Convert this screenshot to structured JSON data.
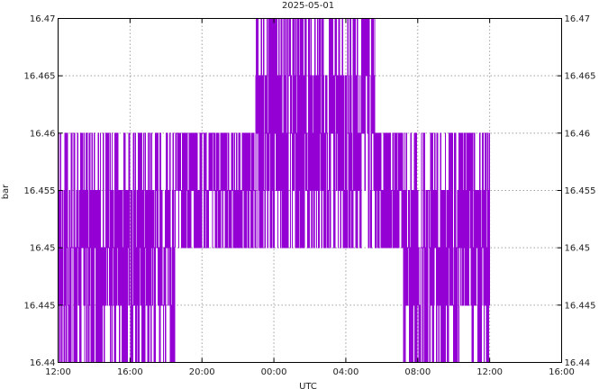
{
  "chart_data": {
    "type": "line",
    "title": "2025-05-01",
    "xlabel": "UTC",
    "ylabel": "bar",
    "x_unit": "hours since 12:00",
    "xlim": [
      0,
      28
    ],
    "ylim": [
      16.44,
      16.47
    ],
    "x_ticks": [
      {
        "x": 0,
        "label": "12:00"
      },
      {
        "x": 4,
        "label": "16:00"
      },
      {
        "x": 8,
        "label": "20:00"
      },
      {
        "x": 12,
        "label": "00:00"
      },
      {
        "x": 16,
        "label": "04:00"
      },
      {
        "x": 20,
        "label": "08:00"
      },
      {
        "x": 24,
        "label": "12:00"
      },
      {
        "x": 28,
        "label": "16:00"
      }
    ],
    "y_ticks": [
      {
        "y": 16.44,
        "label": "16.44"
      },
      {
        "y": 16.445,
        "label": "16.445"
      },
      {
        "y": 16.45,
        "label": "16.45"
      },
      {
        "y": 16.455,
        "label": "16.455"
      },
      {
        "y": 16.46,
        "label": "16.46"
      },
      {
        "y": 16.465,
        "label": "16.465"
      },
      {
        "y": 16.47,
        "label": "16.47"
      }
    ],
    "grid": true,
    "legend": "none",
    "series_color": "#9400d3",
    "series": [
      {
        "segments": [
          {
            "x0": 0.0,
            "x1": 6.5,
            "levels": [
              16.44,
              16.445,
              16.45,
              16.455,
              16.46
            ]
          },
          {
            "x0": 6.5,
            "x1": 11.0,
            "levels": [
              16.45,
              16.455,
              16.46
            ]
          },
          {
            "x0": 11.0,
            "x1": 17.6,
            "levels": [
              16.45,
              16.455,
              16.46,
              16.465,
              16.47
            ]
          },
          {
            "x0": 17.6,
            "x1": 19.2,
            "levels": [
              16.45,
              16.455,
              16.46
            ]
          },
          {
            "x0": 19.2,
            "x1": 24.0,
            "levels": [
              16.44,
              16.445,
              16.45,
              16.455,
              16.46
            ]
          }
        ]
      }
    ]
  }
}
